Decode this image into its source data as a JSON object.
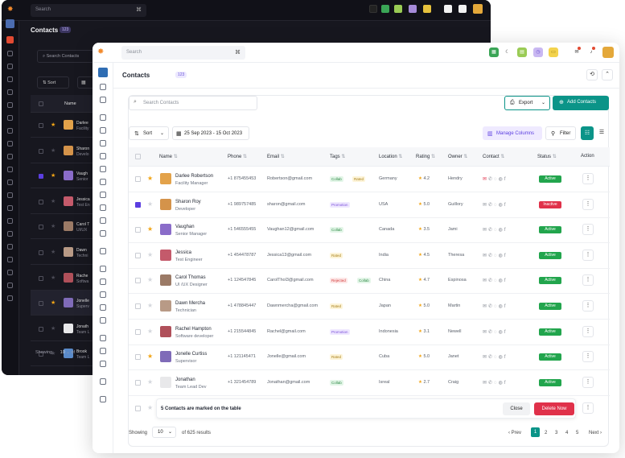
{
  "dark_window": {
    "search_placeholder": "Search",
    "title": "Contacts",
    "count": "123",
    "search_contacts": "Search Contacts",
    "sort_label": "Sort",
    "name_header": "Name",
    "rows": [
      {
        "name": "Darlee",
        "role": "Facility"
      },
      {
        "name": "Sharon",
        "role": "Develo"
      },
      {
        "name": "Vaugh",
        "role": "Senior"
      },
      {
        "name": "Jessica",
        "role": "Test En"
      },
      {
        "name": "Carol T",
        "role": "UI/UX"
      },
      {
        "name": "Dawn",
        "role": "Techni"
      },
      {
        "name": "Rache",
        "role": "Softwa"
      },
      {
        "name": "Jonelle",
        "role": "Superv"
      },
      {
        "name": "Jonath",
        "role": "Team L"
      },
      {
        "name": "Brook",
        "role": "Team L"
      }
    ],
    "showing_label": "Showing",
    "showing_value": "10",
    "of_label": "of"
  },
  "topbar": {
    "search_placeholder": "Search"
  },
  "page": {
    "title": "Contacts",
    "count": "123"
  },
  "toolbar": {
    "search_placeholder": "Search Contacts",
    "export_label": "Export",
    "add_label": "Add Contacts",
    "sort_label": "Sort",
    "date_range": "25 Sep 2023 - 15 Oct 2023",
    "manage_columns": "Manage Columns",
    "filter_label": "Filter"
  },
  "table": {
    "headers": [
      "Name",
      "Phone",
      "Email",
      "Tags",
      "Location",
      "Rating",
      "Owner",
      "Contact",
      "Status",
      "Action"
    ],
    "rows": [
      {
        "name": "Darlee Robertson",
        "role": "Facility Manager",
        "phone": "+1 875455453",
        "email": "Robertson@gmail.com",
        "tags": [
          "Collab",
          "Rated"
        ],
        "location": "Germany",
        "rating": "4.2",
        "owner": "Hendry",
        "status": "Active",
        "starred": true,
        "checked": false,
        "avatar_color": "#e3a24a"
      },
      {
        "name": "Sharon Roy",
        "role": "Developer",
        "phone": "+1 989757485",
        "email": "sharon@gmail.com",
        "tags": [
          "Promotion"
        ],
        "location": "USA",
        "rating": "5.0",
        "owner": "Guillory",
        "status": "Inactive",
        "starred": false,
        "checked": true,
        "avatar_color": "#d4934a"
      },
      {
        "name": "Vaughan",
        "role": "Senior Manager",
        "phone": "+1 546555455",
        "email": "Vaughan12@gmail.com",
        "tags": [
          "Collab"
        ],
        "location": "Canada",
        "rating": "3.5",
        "owner": "Jami",
        "status": "Active",
        "starred": true,
        "checked": false,
        "avatar_color": "#8a6cc9"
      },
      {
        "name": "Jessica",
        "role": "Test Engineer",
        "phone": "+1 454478787",
        "email": "Jessica13@gmail.com",
        "tags": [
          "Rated"
        ],
        "location": "India",
        "rating": "4.5",
        "owner": "Theresa",
        "status": "Active",
        "starred": false,
        "checked": false,
        "avatar_color": "#c45a6b"
      },
      {
        "name": "Carol Thomas",
        "role": "UI /UX Designer",
        "phone": "+1 124547845",
        "email": "CarolThol3@gmail.com",
        "tags": [
          "Rejected",
          "Collab"
        ],
        "location": "China",
        "rating": "4.7",
        "owner": "Espinosa",
        "status": "Active",
        "starred": false,
        "checked": false,
        "avatar_color": "#9b7a66"
      },
      {
        "name": "Dawn Mercha",
        "role": "Technician",
        "phone": "+1 478845447",
        "email": "Dawnmercha@gmail.com",
        "tags": [
          "Rated"
        ],
        "location": "Japan",
        "rating": "5.0",
        "owner": "Martin",
        "status": "Active",
        "starred": false,
        "checked": false,
        "avatar_color": "#b89a86"
      },
      {
        "name": "Rachel Hampton",
        "role": "Software developer",
        "phone": "+1 215544845",
        "email": "Rachel@gmail.com",
        "tags": [
          "Promotion"
        ],
        "location": "Indonesia",
        "rating": "3.1",
        "owner": "Newell",
        "status": "Active",
        "starred": false,
        "checked": false,
        "avatar_color": "#b0505a"
      },
      {
        "name": "Jonelle Curtiss",
        "role": "Supervisor",
        "phone": "+1 121145471",
        "email": "Jonelle@gmail.com",
        "tags": [
          "Rated"
        ],
        "location": "Cuba",
        "rating": "5.0",
        "owner": "Janet",
        "status": "Active",
        "starred": true,
        "checked": false,
        "avatar_color": "#7f6bb8"
      },
      {
        "name": "Jonathan",
        "role": "Team Lead Dev",
        "phone": "+1 321454789",
        "email": "Jonathan@gmail.com",
        "tags": [
          "Collab"
        ],
        "location": "Isreal",
        "rating": "2.7",
        "owner": "Craig",
        "status": "Active",
        "starred": false,
        "checked": false,
        "avatar_color": "#e8e8ea"
      }
    ]
  },
  "selection_bar": {
    "message": "5 Contacts are marked on the table",
    "close_label": "Close",
    "delete_label": "Delete Now"
  },
  "footer": {
    "showing_label": "Showing",
    "per_page": "10",
    "results_text": "of 625 results",
    "prev_label": "Prev",
    "pages": [
      "1",
      "2",
      "3",
      "4",
      "5"
    ],
    "next_label": "Next"
  },
  "colors": {
    "accent": "#0b9488",
    "purple": "#5b3ee0",
    "danger": "#e0314a",
    "active": "#22a54d"
  }
}
